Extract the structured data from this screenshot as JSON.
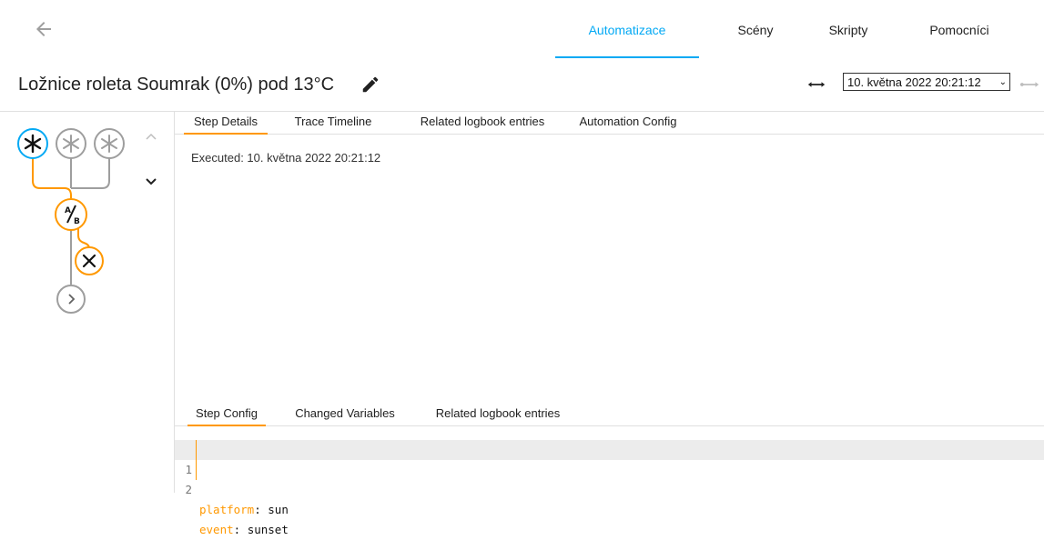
{
  "colors": {
    "accent_blue": "#03a9f4",
    "accent_orange": "#ff9800",
    "node_gray": "#9e9e9e"
  },
  "nav": {
    "back_icon": "arrow-left-icon",
    "tabs": [
      {
        "label": "Automatizace",
        "active": true
      },
      {
        "label": "Scény",
        "active": false
      },
      {
        "label": "Skripty",
        "active": false
      },
      {
        "label": "Pomocníci",
        "active": false
      }
    ]
  },
  "header": {
    "title": "Ložnice roleta Soumrak (0%) pod 13°C",
    "edit_icon": "pencil-icon",
    "range_icon": "arrow-left-right-icon",
    "trace_select_value": "10. května 2022 20:21:12",
    "next_icon": "arrow-right-icon"
  },
  "graph": {
    "nodes": [
      "asterisk-icon",
      "asterisk-icon",
      "asterisk-icon",
      "ab-icon",
      "close-icon",
      "chevron-right-icon"
    ],
    "chevrons": [
      "chevron-up-icon",
      "chevron-down-icon"
    ]
  },
  "details_tabs": [
    {
      "label": "Step Details",
      "active": true
    },
    {
      "label": "Trace Timeline",
      "active": false
    },
    {
      "label": "Related logbook entries",
      "active": false
    },
    {
      "label": "Automation Config",
      "active": false
    }
  ],
  "executed_text": "Executed: 10. května 2022 20:21:12",
  "config_tabs": [
    {
      "label": "Step Config",
      "active": true
    },
    {
      "label": "Changed Variables",
      "active": false
    },
    {
      "label": "Related logbook entries",
      "active": false
    }
  ],
  "code": [
    {
      "num": "1",
      "key": "platform",
      "sep": ": ",
      "value": "sun"
    },
    {
      "num": "2",
      "key": "event",
      "sep": ": ",
      "value": "sunset"
    }
  ]
}
